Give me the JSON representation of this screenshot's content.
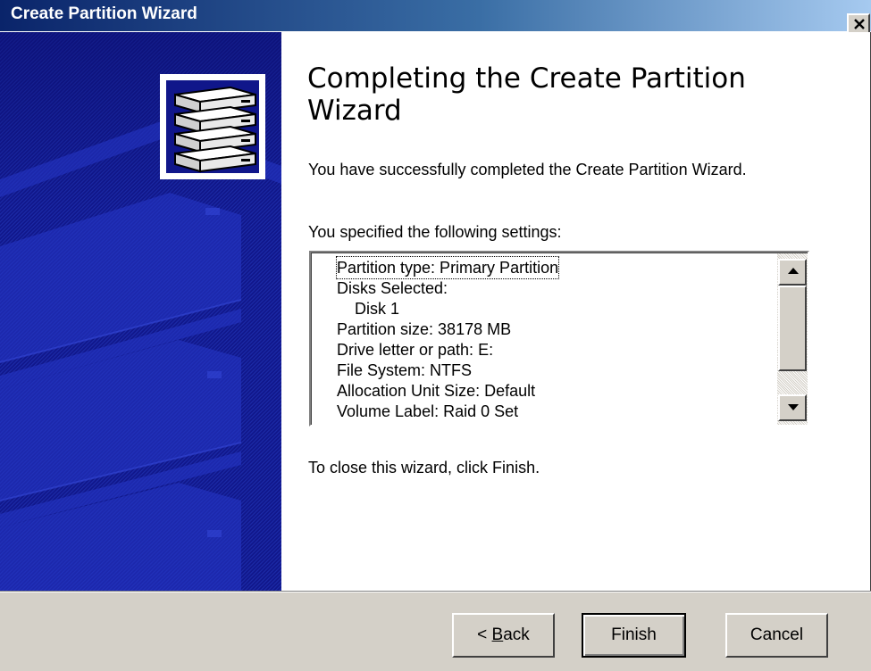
{
  "window": {
    "title": "Create Partition Wizard"
  },
  "wizard": {
    "heading": "Completing the Create Partition Wizard",
    "success_message": "You have successfully completed the Create Partition Wizard.",
    "settings_label": "You specified the following settings:",
    "settings": [
      "Partition type: Primary Partition",
      "Disks Selected:",
      "Disk 1",
      "Partition size: 38178 MB",
      "Drive letter or path: E:",
      "File System: NTFS",
      "Allocation Unit Size: Default",
      "Volume Label: Raid 0 Set"
    ],
    "finish_hint": "To close this wizard, click Finish."
  },
  "buttons": {
    "back_prefix": "< ",
    "back_mnemonic": "B",
    "back_rest": "ack",
    "finish": "Finish",
    "cancel": "Cancel"
  },
  "colors": {
    "title_bar": "#0a246a",
    "side_panel": "#10168a",
    "button_face": "#d4d0c8"
  },
  "icons": {
    "side_panel": "disk-stack-icon",
    "close": "close-icon",
    "scroll_up": "scroll-up-arrow-icon",
    "scroll_down": "scroll-down-arrow-icon"
  }
}
